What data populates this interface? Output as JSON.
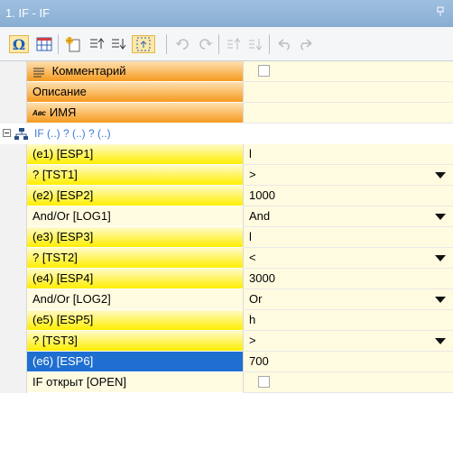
{
  "window": {
    "title": "1. IF - IF",
    "pin_glyph": "ᵖ"
  },
  "toolbar": {
    "buttons": [
      {
        "icon": "omega-icon",
        "glyph": "Ω",
        "selected": true
      },
      {
        "icon": "calendar-grid-icon",
        "selected": false
      },
      {
        "icon": "new-item-icon",
        "selected": false
      },
      {
        "icon": "sort-ascending-icon",
        "selected": false
      },
      {
        "icon": "sort-descending-icon",
        "selected": false
      },
      {
        "icon": "dotted-select-icon",
        "selected": true
      },
      {
        "icon": "rotate-left-icon",
        "disabled": true
      },
      {
        "icon": "rotate-right-icon",
        "disabled": true
      },
      {
        "icon": "move-up-icon",
        "disabled": true
      },
      {
        "icon": "move-down-icon",
        "disabled": true
      },
      {
        "icon": "undo-icon",
        "disabled": true
      },
      {
        "icon": "redo-icon",
        "disabled": true
      }
    ]
  },
  "header_rows": [
    {
      "label": "Комментарий",
      "icon": "comment-lines-icon",
      "value_type": "checkbox",
      "checked": false
    },
    {
      "label": "Описание",
      "value": ""
    },
    {
      "label": "ИМЯ",
      "prefix": "Авс",
      "value": ""
    }
  ],
  "group": {
    "label": "IF (..) ? (..) ? (..)",
    "icon": "network-icon",
    "expanded": true
  },
  "rows": [
    {
      "label": "(e1) [ESP1]",
      "style": "yellow",
      "value": "l",
      "dropdown": false
    },
    {
      "label": "? [TST1]",
      "style": "yellow",
      "value": ">",
      "dropdown": true
    },
    {
      "label": "(e2) [ESP2]",
      "style": "yellow",
      "value": "1000",
      "dropdown": false
    },
    {
      "label": "And/Or [LOG1]",
      "style": "plain",
      "value": "And",
      "dropdown": true
    },
    {
      "label": "(e3) [ESP3]",
      "style": "yellow",
      "value": "l",
      "dropdown": false
    },
    {
      "label": "? [TST2]",
      "style": "yellow",
      "value": "<",
      "dropdown": true
    },
    {
      "label": "(e4) [ESP4]",
      "style": "yellow",
      "value": "3000",
      "dropdown": false
    },
    {
      "label": "And/Or [LOG2]",
      "style": "plain",
      "value": "Or",
      "dropdown": true
    },
    {
      "label": "(e5) [ESP5]",
      "style": "yellow",
      "value": "h",
      "dropdown": false
    },
    {
      "label": "? [TST3]",
      "style": "yellow",
      "value": ">",
      "dropdown": true
    },
    {
      "label": "(e6) [ESP6]",
      "style": "selected",
      "value": "700",
      "dropdown": false
    },
    {
      "label": "IF открыт [OPEN]",
      "style": "plain",
      "value_type": "checkbox",
      "checked": false
    }
  ],
  "colors": {
    "title_bar": "#88aed3",
    "orange": "#f59a1f",
    "yellow": "#ffee00",
    "selected": "#1f6fd1",
    "value_bg": "#fffbe0",
    "group_text": "#3a7bd5"
  }
}
